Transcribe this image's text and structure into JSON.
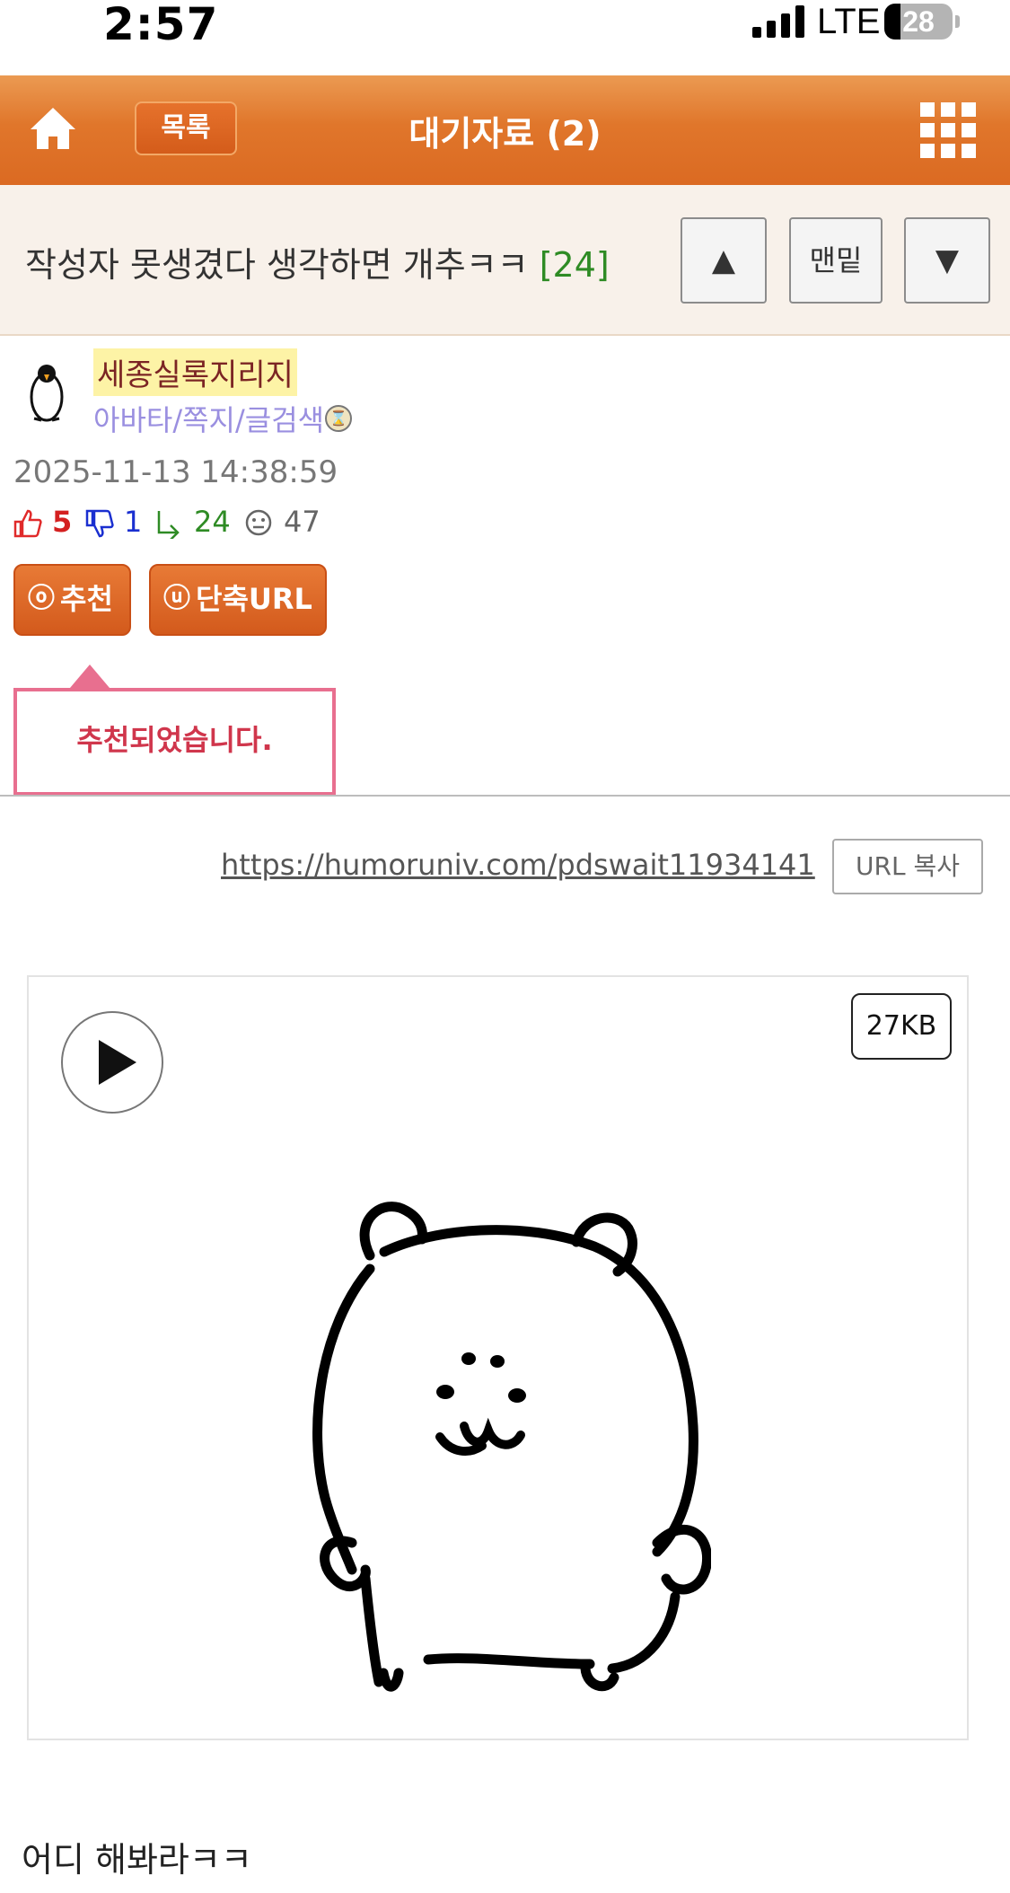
{
  "status_bar": {
    "time": "2:57",
    "network": "LTE",
    "battery": "28",
    "battery_level": 0.28
  },
  "header": {
    "title": "대기자료 (2)",
    "list_button": "목록",
    "home_icon": "home-icon",
    "menu_icon": "grid-menu-icon",
    "accent_color": "#e0762b"
  },
  "post": {
    "title": "작성자 못생겼다 생각하면 개추ㅋㅋ",
    "comment_count": "[24]",
    "nav": {
      "up": "▲",
      "bottom": "맨밑",
      "down": "▼"
    },
    "author": {
      "name": "세종실록지리지",
      "links": "아바타/쪽지/글검색"
    },
    "date": "2025-11-13 14:38:59",
    "stats": {
      "likes": "5",
      "dislikes": "1",
      "replies": "24",
      "views": "47"
    },
    "buttons": {
      "recommend": "추천",
      "recommend_icon": "ⓞ",
      "short_url": "단축URL",
      "short_url_icon": "ⓤ"
    },
    "tooltip": "추천되었습니다.",
    "url": "https://humoruniv.com/pdswait11934141",
    "copy_url": "URL 복사",
    "media": {
      "size": "27KB"
    },
    "body_text": "어디 해봐라ㅋㅋ"
  }
}
